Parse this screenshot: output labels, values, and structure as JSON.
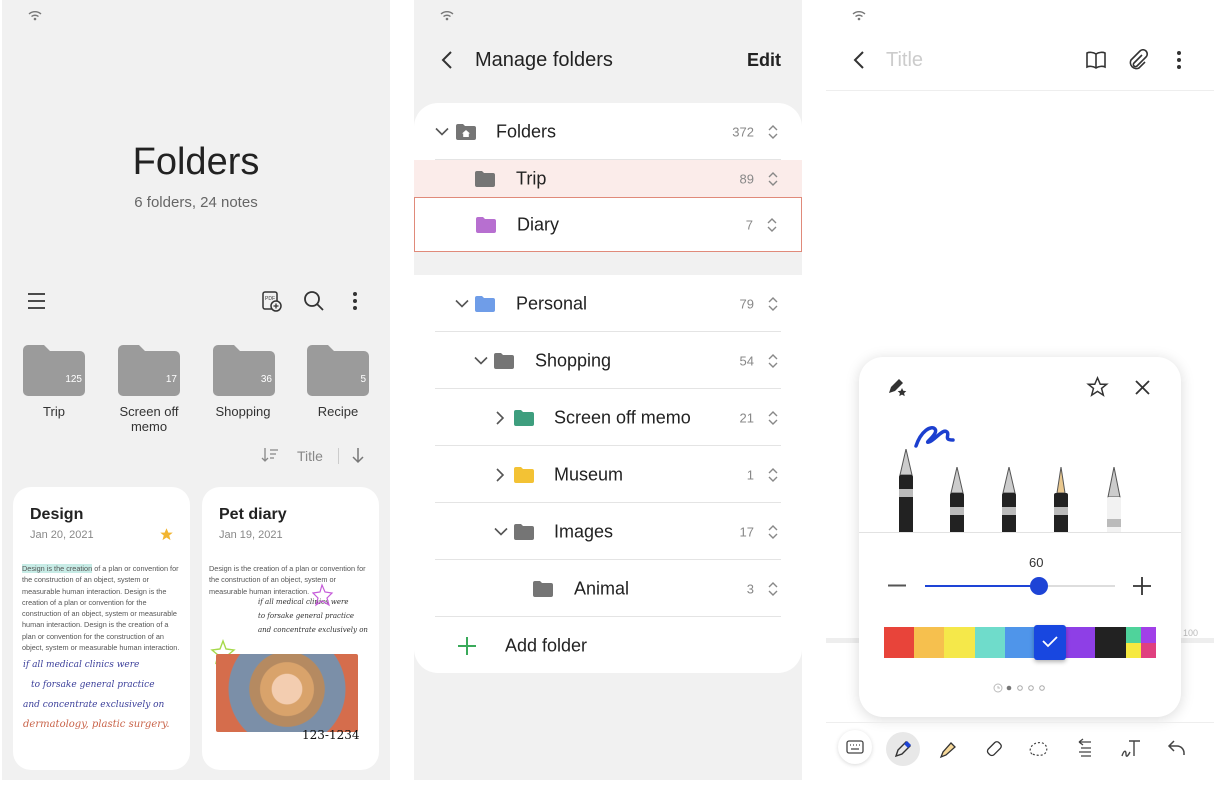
{
  "screen1": {
    "title": "Folders",
    "subtitle": "6 folders, 24 notes",
    "toolbar_icons": [
      "menu-icon",
      "pdf-add-icon",
      "search-icon",
      "more-icon"
    ],
    "folders": [
      {
        "name": "Trip",
        "count": "125"
      },
      {
        "name": "Screen off memo",
        "count": "17"
      },
      {
        "name": "Shopping",
        "count": "36"
      },
      {
        "name": "Recipe",
        "count": "5"
      }
    ],
    "sort": {
      "label": "Title"
    },
    "notes": [
      {
        "title": "Design",
        "date": "Jan 20, 2021",
        "starred": true,
        "highlight": "Design is the creation",
        "text": " of a plan or convention for the construction of an object, system or measurable human interaction. Design is the creation of a plan or convention for the construction of an object, system or measurable human interaction. Design is the creation of a plan or convention for the construction of an object, system or measurable human interaction.",
        "handwriting": [
          "if all medical clinics were",
          "to forsake general practice",
          "and concentrate exclusively on",
          "dermatology, plastic surgery."
        ]
      },
      {
        "title": "Pet diary",
        "date": "Jan 19, 2021",
        "text": "Design is the creation of a plan or convention for the construction of an object, system or measurable human interaction.",
        "handwriting": [
          "if all medical clinics were",
          "to forsake general practice",
          "and concentrate exclusively on"
        ],
        "photo_caption": "123-1234"
      }
    ]
  },
  "screen2": {
    "title": "Manage folders",
    "edit_label": "Edit",
    "rows": [
      {
        "name": "Folders",
        "count": "372"
      },
      {
        "name": "Trip",
        "count": "89"
      },
      {
        "name": "Diary",
        "count": "7"
      },
      {
        "name": "Personal",
        "count": "79"
      },
      {
        "name": "Shopping",
        "count": "54"
      },
      {
        "name": "Screen off memo",
        "count": "21"
      },
      {
        "name": "Museum",
        "count": "1"
      },
      {
        "name": "Images",
        "count": "17"
      },
      {
        "name": "Animal",
        "count": "3"
      }
    ],
    "add_folder": "Add folder",
    "colors": {
      "diary": "#b76fd0",
      "personal": "#6f9de8",
      "screen_off_memo": "#3e9e7e",
      "museum": "#f3c234",
      "default": "#757575",
      "add": "#3aaa5a",
      "drag_border": "#e08a7a"
    }
  },
  "screen3": {
    "title_placeholder": "Title",
    "header_icons": [
      "book-icon",
      "attach-icon",
      "more-icon"
    ],
    "pen_settings": {
      "size_value": "60",
      "size_fraction": 0.6,
      "pens": [
        "fountain-pen",
        "calligraphy-pen",
        "pen",
        "pencil",
        "brush"
      ],
      "colors": [
        "#e8443a",
        "#f6c04e",
        "#f5e84a",
        "#6fdccb",
        "#4f95ea",
        "#1847e0",
        "#8e3fe6",
        "#222222"
      ],
      "selected_color": "#1847e0",
      "page": 1,
      "pages": 4
    },
    "ruler_value": "100",
    "bottom_tools": [
      "keyboard-icon",
      "pen-icon",
      "highlighter-icon",
      "eraser-icon",
      "lasso-icon",
      "text-align-icon",
      "handwriting-to-text-icon",
      "undo-icon"
    ]
  }
}
